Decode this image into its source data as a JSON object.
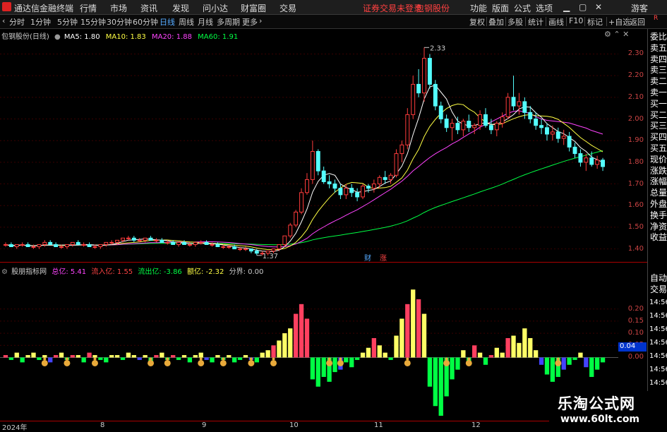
{
  "titlebar": {
    "app_title": "通达信金融终端",
    "menus": [
      "行情",
      "市场",
      "资讯",
      "发现",
      "问小达",
      "财富圈",
      "交易"
    ],
    "notice": "证券交易未登录",
    "stock": "包钢股份",
    "right_menus": [
      "功能",
      "版面",
      "公式",
      "选项"
    ],
    "guest": "游客",
    "colors": {
      "notice": "#ff4040",
      "stock": "#ff4040"
    }
  },
  "toolbar": {
    "periods": [
      "分时",
      "1分钟",
      "5分钟",
      "15分钟",
      "30分钟",
      "60分钟",
      "日线",
      "周线",
      "月线",
      "多周期",
      "更多"
    ],
    "active_period": "日线",
    "right_buttons": [
      "复权",
      "叠加",
      "多股",
      "统计",
      "画线",
      "F10",
      "标记",
      "+自选",
      "返回"
    ]
  },
  "main_legend": {
    "name": "包钢股份(日线)",
    "ma5": "MA5: 1.80",
    "ma10": "MA10: 1.83",
    "ma20": "MA20: 1.88",
    "ma60": "MA60: 1.91",
    "high_label": "2.33",
    "low_label": "1.37",
    "cai_label": "财",
    "zhang_label": "涨"
  },
  "sub_legend": {
    "name": "股朋指标网",
    "total": "总亿: 5.41",
    "inflow": "流入亿: 1.55",
    "outflow": "流出亿: -3.86",
    "amount": "额亿: -2.32",
    "boundary": "分界: 0.00",
    "value_box": "0.04"
  },
  "right_panel": {
    "corner": "R",
    "items": [
      "委比",
      "卖五",
      "卖四",
      "卖三",
      "卖二",
      "卖一",
      "买一",
      "买二",
      "买三",
      "买四",
      "买五",
      "现价",
      "涨跌",
      "涨幅",
      "总量",
      "外盘",
      "换手",
      "净资",
      "收益"
    ],
    "sub_items": [
      "自动",
      "交易"
    ],
    "times": [
      "14:56",
      "14:56",
      "14:56",
      "14:56",
      "14:56",
      "14:56",
      "14:56"
    ]
  },
  "bottom_axis": {
    "labels": [
      "2024年",
      "8",
      "9",
      "10",
      "11",
      "12"
    ]
  },
  "watermark": {
    "line1": "乐淘公式网",
    "line2": "www.60lt.com"
  },
  "chart_data": [
    {
      "type": "candlestick",
      "title": "包钢股份(日线)",
      "ylim": [
        1.34,
        2.37
      ],
      "yticks": [
        1.4,
        1.5,
        1.6,
        1.7,
        1.8,
        1.9,
        2.0,
        2.1,
        2.2,
        2.3
      ],
      "ma_values": {
        "MA5": 1.8,
        "MA10": 1.83,
        "MA20": 1.88,
        "MA60": 1.91
      },
      "series_colors": {
        "up": "#ff3c3c",
        "down": "#54ffff",
        "MA5": "#ffffff",
        "MA10": "#ffff44",
        "MA20": "#ff44ff",
        "MA60": "#00ff44"
      },
      "annotations": {
        "high": 2.33,
        "low": 1.37
      },
      "ohlc": [
        [
          1.42,
          1.43,
          1.41,
          1.42
        ],
        [
          1.42,
          1.43,
          1.41,
          1.41
        ],
        [
          1.41,
          1.42,
          1.4,
          1.42
        ],
        [
          1.42,
          1.43,
          1.41,
          1.42
        ],
        [
          1.42,
          1.43,
          1.41,
          1.41
        ],
        [
          1.41,
          1.42,
          1.4,
          1.41
        ],
        [
          1.41,
          1.42,
          1.4,
          1.42
        ],
        [
          1.42,
          1.44,
          1.41,
          1.43
        ],
        [
          1.43,
          1.44,
          1.42,
          1.42
        ],
        [
          1.42,
          1.43,
          1.41,
          1.41
        ],
        [
          1.41,
          1.42,
          1.4,
          1.41
        ],
        [
          1.41,
          1.42,
          1.4,
          1.42
        ],
        [
          1.42,
          1.43,
          1.41,
          1.43
        ],
        [
          1.43,
          1.44,
          1.42,
          1.42
        ],
        [
          1.42,
          1.43,
          1.41,
          1.42
        ],
        [
          1.42,
          1.43,
          1.41,
          1.41
        ],
        [
          1.41,
          1.42,
          1.4,
          1.41
        ],
        [
          1.41,
          1.42,
          1.4,
          1.42
        ],
        [
          1.42,
          1.43,
          1.41,
          1.43
        ],
        [
          1.43,
          1.44,
          1.42,
          1.43
        ],
        [
          1.43,
          1.44,
          1.42,
          1.44
        ],
        [
          1.44,
          1.45,
          1.43,
          1.45
        ],
        [
          1.45,
          1.46,
          1.44,
          1.45
        ],
        [
          1.45,
          1.46,
          1.43,
          1.44
        ],
        [
          1.44,
          1.45,
          1.43,
          1.44
        ],
        [
          1.44,
          1.45,
          1.43,
          1.45
        ],
        [
          1.45,
          1.46,
          1.44,
          1.44
        ],
        [
          1.44,
          1.45,
          1.43,
          1.44
        ],
        [
          1.44,
          1.45,
          1.43,
          1.43
        ],
        [
          1.43,
          1.44,
          1.42,
          1.43
        ],
        [
          1.43,
          1.44,
          1.42,
          1.42
        ],
        [
          1.42,
          1.43,
          1.41,
          1.43
        ],
        [
          1.43,
          1.44,
          1.42,
          1.42
        ],
        [
          1.42,
          1.43,
          1.41,
          1.42
        ],
        [
          1.42,
          1.43,
          1.41,
          1.43
        ],
        [
          1.43,
          1.44,
          1.42,
          1.43
        ],
        [
          1.43,
          1.44,
          1.42,
          1.42
        ],
        [
          1.42,
          1.43,
          1.41,
          1.42
        ],
        [
          1.42,
          1.43,
          1.41,
          1.41
        ],
        [
          1.41,
          1.42,
          1.4,
          1.41
        ],
        [
          1.41,
          1.42,
          1.4,
          1.41
        ],
        [
          1.41,
          1.42,
          1.4,
          1.4
        ],
        [
          1.4,
          1.41,
          1.39,
          1.4
        ],
        [
          1.4,
          1.41,
          1.39,
          1.4
        ],
        [
          1.4,
          1.4,
          1.38,
          1.39
        ],
        [
          1.39,
          1.4,
          1.37,
          1.38
        ],
        [
          1.38,
          1.39,
          1.37,
          1.38
        ],
        [
          1.38,
          1.39,
          1.37,
          1.39
        ],
        [
          1.39,
          1.4,
          1.38,
          1.4
        ],
        [
          1.4,
          1.42,
          1.39,
          1.42
        ],
        [
          1.42,
          1.46,
          1.41,
          1.46
        ],
        [
          1.46,
          1.52,
          1.45,
          1.51
        ],
        [
          1.51,
          1.58,
          1.5,
          1.57
        ],
        [
          1.57,
          1.68,
          1.56,
          1.66
        ],
        [
          1.66,
          1.75,
          1.65,
          1.72
        ],
        [
          1.72,
          1.9,
          1.7,
          1.85
        ],
        [
          1.85,
          1.86,
          1.74,
          1.76
        ],
        [
          1.76,
          1.78,
          1.7,
          1.71
        ],
        [
          1.71,
          1.74,
          1.68,
          1.7
        ],
        [
          1.7,
          1.72,
          1.66,
          1.68
        ],
        [
          1.68,
          1.7,
          1.63,
          1.65
        ],
        [
          1.65,
          1.7,
          1.63,
          1.68
        ],
        [
          1.68,
          1.7,
          1.64,
          1.66
        ],
        [
          1.66,
          1.68,
          1.62,
          1.64
        ],
        [
          1.64,
          1.7,
          1.63,
          1.69
        ],
        [
          1.69,
          1.7,
          1.66,
          1.68
        ],
        [
          1.68,
          1.72,
          1.66,
          1.7
        ],
        [
          1.7,
          1.74,
          1.68,
          1.73
        ],
        [
          1.73,
          1.76,
          1.7,
          1.72
        ],
        [
          1.72,
          1.75,
          1.7,
          1.74
        ],
        [
          1.74,
          1.86,
          1.73,
          1.84
        ],
        [
          1.84,
          1.9,
          1.8,
          1.88
        ],
        [
          1.88,
          2.05,
          1.86,
          2.02
        ],
        [
          2.02,
          2.2,
          2.0,
          2.16
        ],
        [
          2.16,
          2.23,
          2.1,
          2.12
        ],
        [
          2.12,
          2.33,
          2.08,
          2.28
        ],
        [
          2.28,
          2.3,
          2.14,
          2.16
        ],
        [
          2.16,
          2.18,
          2.04,
          2.06
        ],
        [
          2.06,
          2.08,
          1.98,
          2.0
        ],
        [
          2.0,
          2.02,
          1.94,
          1.96
        ],
        [
          1.96,
          2.0,
          1.9,
          1.98
        ],
        [
          1.98,
          2.01,
          1.93,
          1.95
        ],
        [
          1.95,
          2.0,
          1.92,
          1.99
        ],
        [
          1.99,
          2.02,
          1.94,
          1.96
        ],
        [
          1.96,
          1.98,
          1.93,
          1.97
        ],
        [
          1.97,
          2.04,
          1.95,
          2.02
        ],
        [
          2.02,
          2.05,
          1.96,
          1.97
        ],
        [
          1.97,
          2.0,
          1.93,
          1.95
        ],
        [
          1.95,
          1.99,
          1.92,
          1.98
        ],
        [
          1.98,
          2.03,
          1.96,
          2.01
        ],
        [
          2.01,
          2.12,
          2.0,
          2.1
        ],
        [
          2.1,
          2.2,
          2.04,
          2.06
        ],
        [
          2.06,
          2.12,
          2.02,
          2.08
        ],
        [
          2.08,
          2.1,
          2.0,
          2.03
        ],
        [
          2.03,
          2.06,
          1.98,
          2.0
        ],
        [
          2.0,
          2.03,
          1.95,
          1.97
        ],
        [
          1.97,
          2.0,
          1.93,
          1.96
        ],
        [
          1.96,
          1.98,
          1.9,
          1.93
        ],
        [
          1.93,
          1.97,
          1.9,
          1.94
        ],
        [
          1.94,
          1.96,
          1.89,
          1.91
        ],
        [
          1.91,
          1.95,
          1.88,
          1.92
        ],
        [
          1.92,
          1.94,
          1.85,
          1.87
        ],
        [
          1.87,
          1.89,
          1.82,
          1.84
        ],
        [
          1.84,
          1.86,
          1.78,
          1.8
        ],
        [
          1.8,
          1.84,
          1.76,
          1.82
        ],
        [
          1.82,
          1.85,
          1.78,
          1.79
        ],
        [
          1.79,
          1.83,
          1.77,
          1.81
        ],
        [
          1.81,
          1.82,
          1.76,
          1.78
        ]
      ]
    },
    {
      "type": "bar",
      "title": "股朋指标网",
      "ylim": [
        -0.24,
        0.33
      ],
      "yticks": [
        0.0,
        0.05,
        0.1,
        0.15,
        0.2
      ],
      "series_colors": {
        "pos_strong": "#ff4060",
        "pos_mid": "#ffff66",
        "neg": "#00ff44",
        "neg_blue": "#4444ff"
      },
      "values": [
        0.01,
        -0.01,
        0.02,
        -0.02,
        0.01,
        0.02,
        -0.01,
        0.01,
        -0.02,
        0.01,
        0.02,
        -0.01,
        0.01,
        0.01,
        -0.02,
        0.02,
        0.01,
        -0.01,
        -0.02,
        0.01,
        0.01,
        -0.01,
        0.02,
        0.01,
        -0.01,
        0.01,
        -0.02,
        0.01,
        0.02,
        -0.01,
        0.01,
        -0.01,
        0.01,
        -0.02,
        0.01,
        0.02,
        -0.01,
        -0.02,
        0.01,
        -0.01,
        0.01,
        -0.02,
        -0.01,
        0.01,
        -0.01,
        -0.02,
        0.02,
        0.03,
        0.05,
        0.07,
        0.1,
        0.12,
        0.18,
        0.22,
        0.16,
        -0.09,
        -0.12,
        -0.08,
        -0.1,
        -0.06,
        -0.05,
        -0.02,
        -0.04,
        -0.01,
        0.02,
        0.04,
        0.08,
        0.05,
        0.02,
        -0.01,
        0.09,
        0.16,
        0.22,
        0.28,
        0.24,
        0.18,
        -0.12,
        -0.2,
        -0.24,
        -0.16,
        -0.09,
        -0.05,
        0.03,
        -0.02,
        0.05,
        0.02,
        -0.03,
        0.01,
        0.04,
        0.02,
        0.08,
        0.09,
        0.06,
        0.12,
        0.08,
        0.03,
        -0.03,
        -0.07,
        -0.1,
        -0.08,
        -0.05,
        -0.03,
        -0.01,
        0.02,
        -0.04,
        -0.08,
        -0.05,
        -0.02
      ],
      "markers": [
        7,
        11,
        16,
        26,
        29,
        35,
        39,
        44,
        48,
        58,
        60,
        72,
        79,
        83,
        99
      ]
    }
  ]
}
